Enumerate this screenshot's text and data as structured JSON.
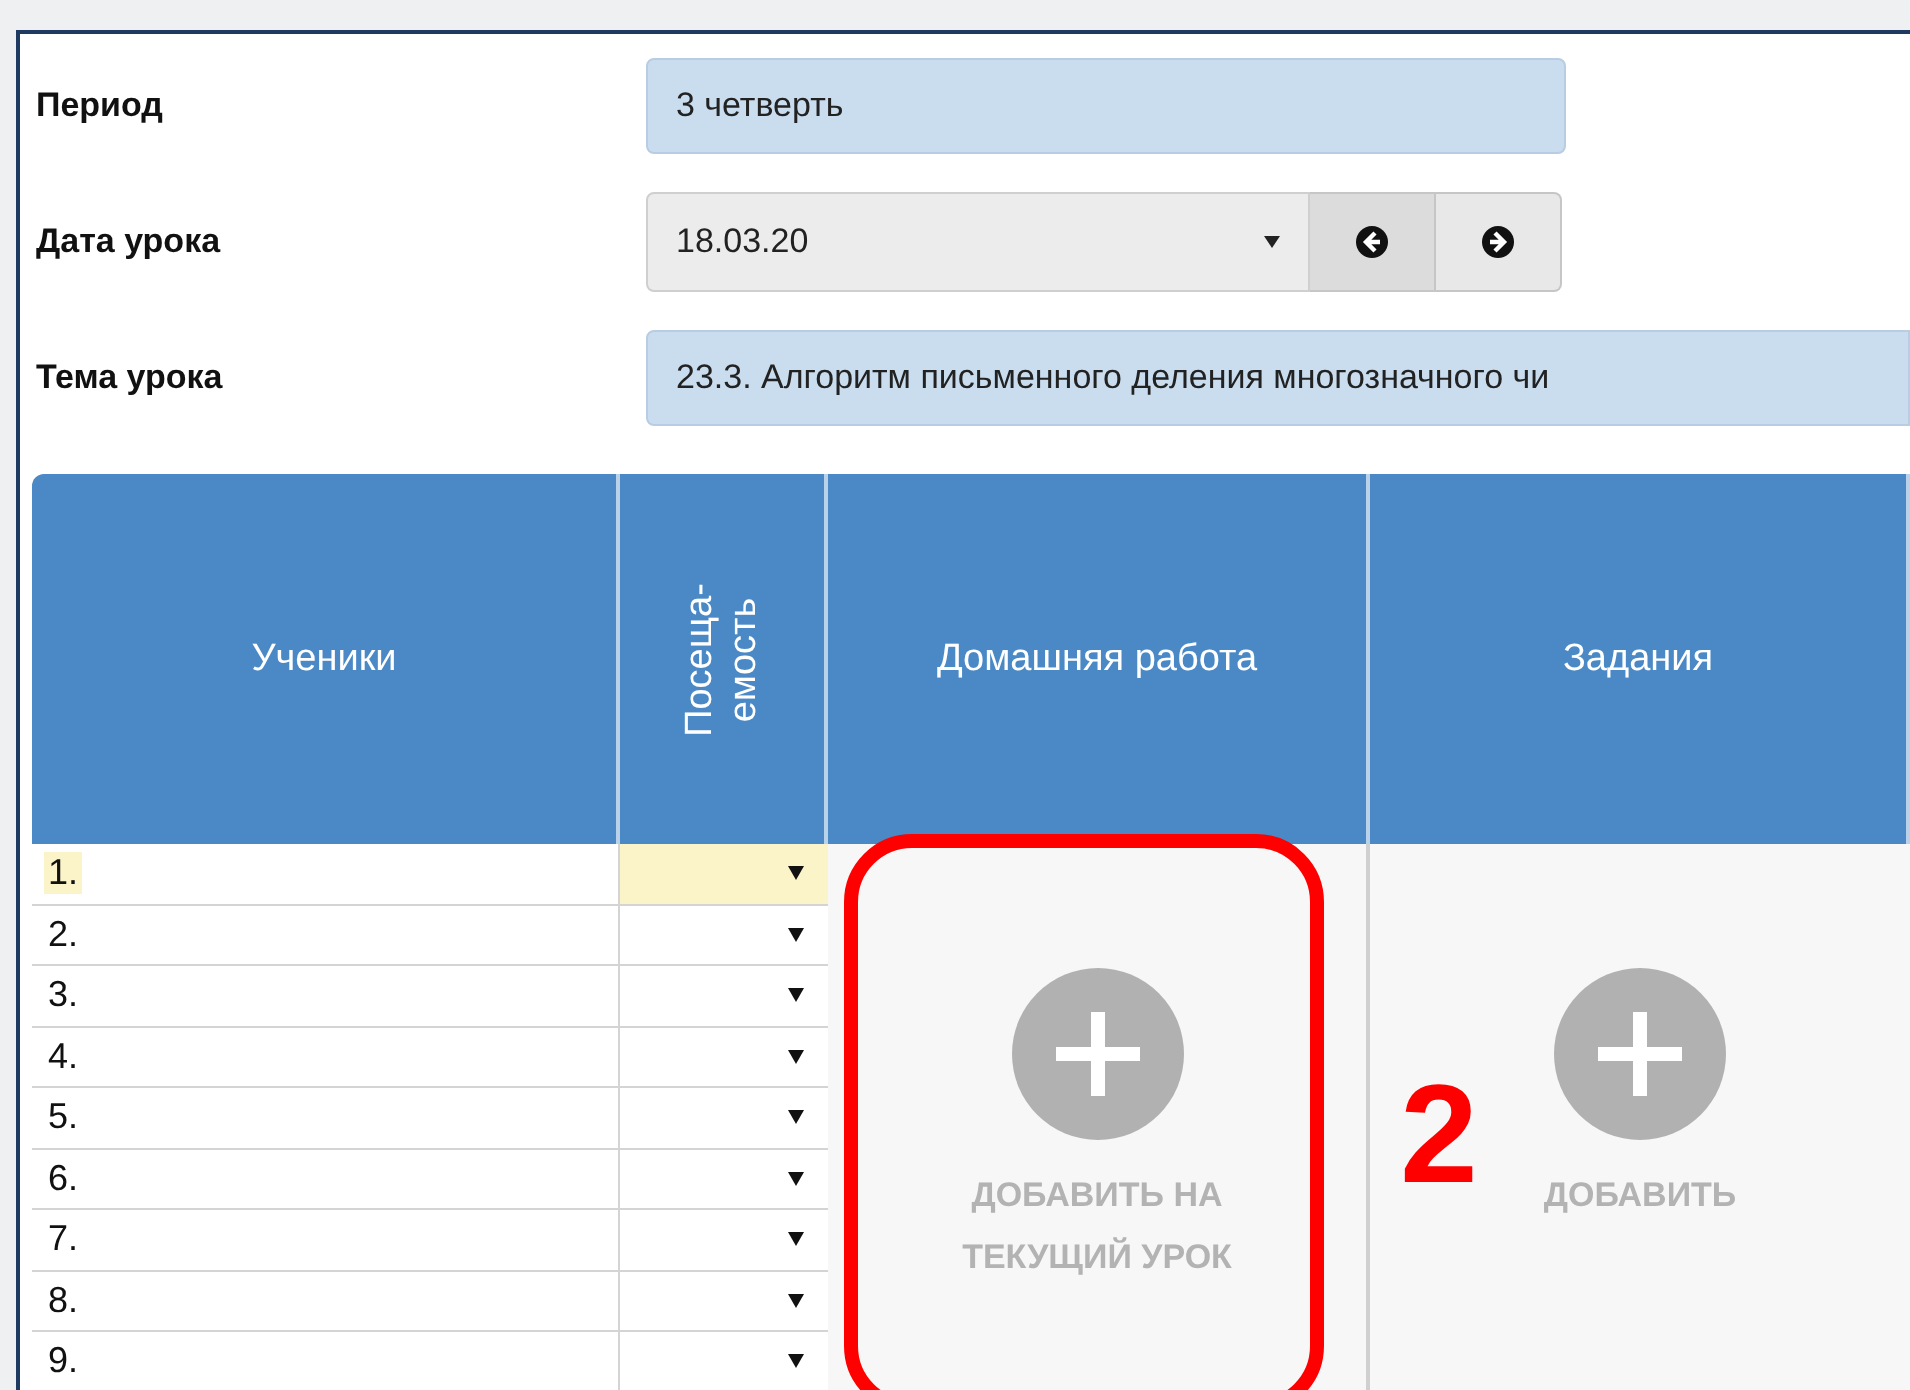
{
  "form": [
    {
      "kind": "text",
      "label": "Период",
      "value": "3 четверть"
    },
    {
      "kind": "date",
      "label": "Дата урока",
      "value": "18.03.20"
    },
    {
      "kind": "wide",
      "label": "Тема урока",
      "value": "23.3. Алгоритм письменного деления многозначного чи"
    }
  ],
  "table": {
    "columns": [
      {
        "kind": "plain",
        "label": "Ученики"
      },
      {
        "kind": "vertical",
        "label": "Посеща-\nемость"
      },
      {
        "kind": "plain",
        "label": "Домашняя работа"
      },
      {
        "kind": "plain",
        "label": "Задания"
      }
    ],
    "rows": [
      {
        "number": "1.",
        "selected": true
      },
      {
        "number": "2.",
        "selected": false
      },
      {
        "number": "3.",
        "selected": false
      },
      {
        "number": "4.",
        "selected": false
      },
      {
        "number": "5.",
        "selected": false
      },
      {
        "number": "6.",
        "selected": false
      },
      {
        "number": "7.",
        "selected": false
      },
      {
        "number": "8.",
        "selected": false
      },
      {
        "number": "9.",
        "selected": false
      }
    ],
    "homework": {
      "label": "ДОБАВИТЬ НА ТЕКУЩИЙ УРОК"
    },
    "tasks": {
      "label": "ДОБАВИТЬ"
    }
  },
  "annotation": {
    "number": "2"
  }
}
